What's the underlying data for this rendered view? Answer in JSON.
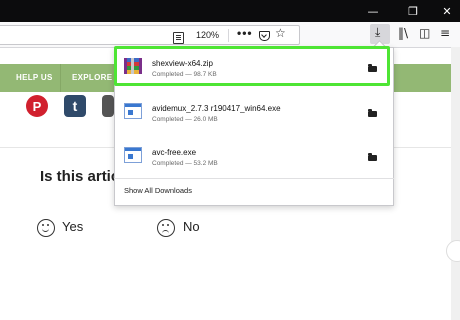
{
  "toolbar": {
    "zoom_level": "120%"
  },
  "site_nav": {
    "items": [
      "HELP US",
      "EXPLORE"
    ]
  },
  "social_icons": [
    {
      "name": "pinterest-icon",
      "glyph": "P",
      "color": "#d1202e"
    },
    {
      "name": "tumblr-icon",
      "glyph": "t",
      "color": "#2f4a6a"
    }
  ],
  "article": {
    "question": "Is this artic",
    "yes_label": "Yes",
    "no_label": "No"
  },
  "downloads": {
    "items": [
      {
        "filename": "shexview-x64.zip",
        "status": "Completed — 98.7 KB",
        "icon": "archive-icon"
      },
      {
        "filename": "avidemux_2.7.3 r190417_win64.exe",
        "status": "Completed — 26.0 MB",
        "icon": "exe-file-icon"
      },
      {
        "filename": "avc-free.exe",
        "status": "Completed — 53.2 MB",
        "icon": "exe-file-icon"
      }
    ],
    "show_all_label": "Show All Downloads"
  },
  "colors": {
    "highlight": "#4ee534",
    "site_nav_bg": "#93b874",
    "title_bar": "#0c0c0d"
  }
}
